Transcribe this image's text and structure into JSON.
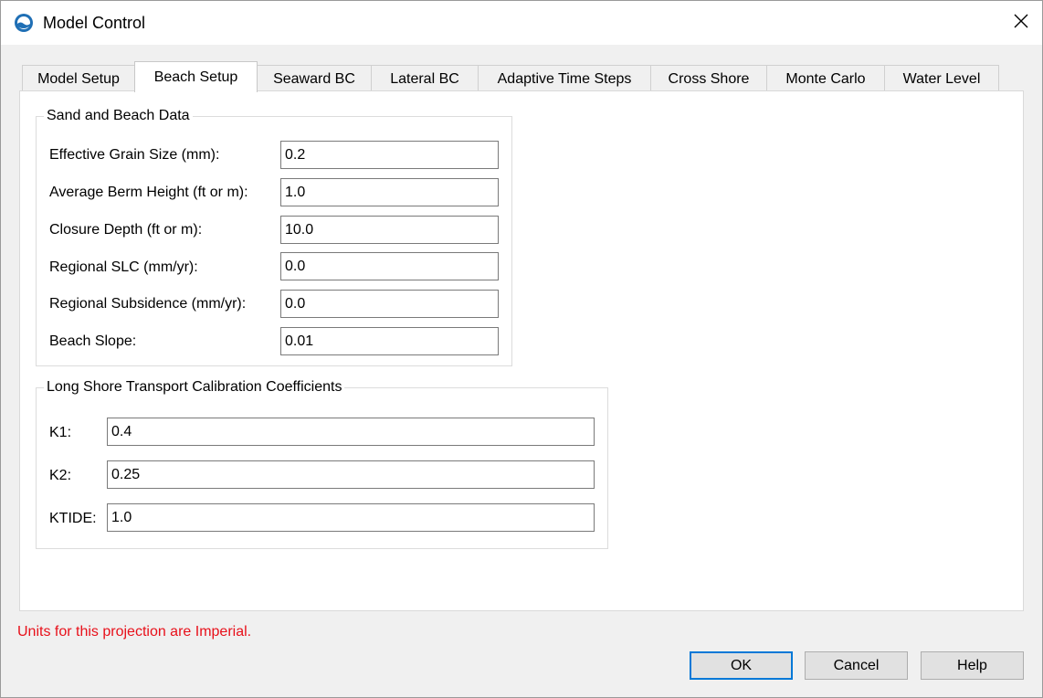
{
  "window": {
    "title": "Model Control",
    "app_icon": "globe-water-icon",
    "close_icon": "close-icon"
  },
  "tabs": [
    {
      "label": "Model Setup",
      "active": false
    },
    {
      "label": "Beach Setup",
      "active": true
    },
    {
      "label": "Seaward BC",
      "active": false
    },
    {
      "label": "Lateral BC",
      "active": false
    },
    {
      "label": "Adaptive Time Steps",
      "active": false
    },
    {
      "label": "Cross Shore",
      "active": false
    },
    {
      "label": "Monte Carlo",
      "active": false
    },
    {
      "label": "Water Level",
      "active": false
    }
  ],
  "sand_group": {
    "legend": "Sand and Beach Data",
    "fields": [
      {
        "label": "Effective Grain Size (mm):",
        "value": "0.2"
      },
      {
        "label": "Average Berm Height (ft or m):",
        "value": "1.0"
      },
      {
        "label": "Closure Depth (ft or m):",
        "value": "10.0"
      },
      {
        "label": "Regional SLC (mm/yr):",
        "value": "0.0"
      },
      {
        "label": "Regional Subsidence (mm/yr):",
        "value": "0.0"
      },
      {
        "label": "Beach Slope:",
        "value": "0.01"
      }
    ]
  },
  "lst_group": {
    "legend": "Long Shore Transport Calibration Coefficients",
    "fields": [
      {
        "label": "K1:",
        "value": "0.4"
      },
      {
        "label": "K2:",
        "value": "0.25"
      },
      {
        "label": "KTIDE:",
        "value": "1.0"
      }
    ]
  },
  "status": {
    "text": "Units for this projection are Imperial.",
    "color": "#e8101a"
  },
  "buttons": {
    "ok": "OK",
    "cancel": "Cancel",
    "help": "Help"
  },
  "colors": {
    "accent": "#0078d7",
    "icon_blue": "#1f6fb5"
  }
}
